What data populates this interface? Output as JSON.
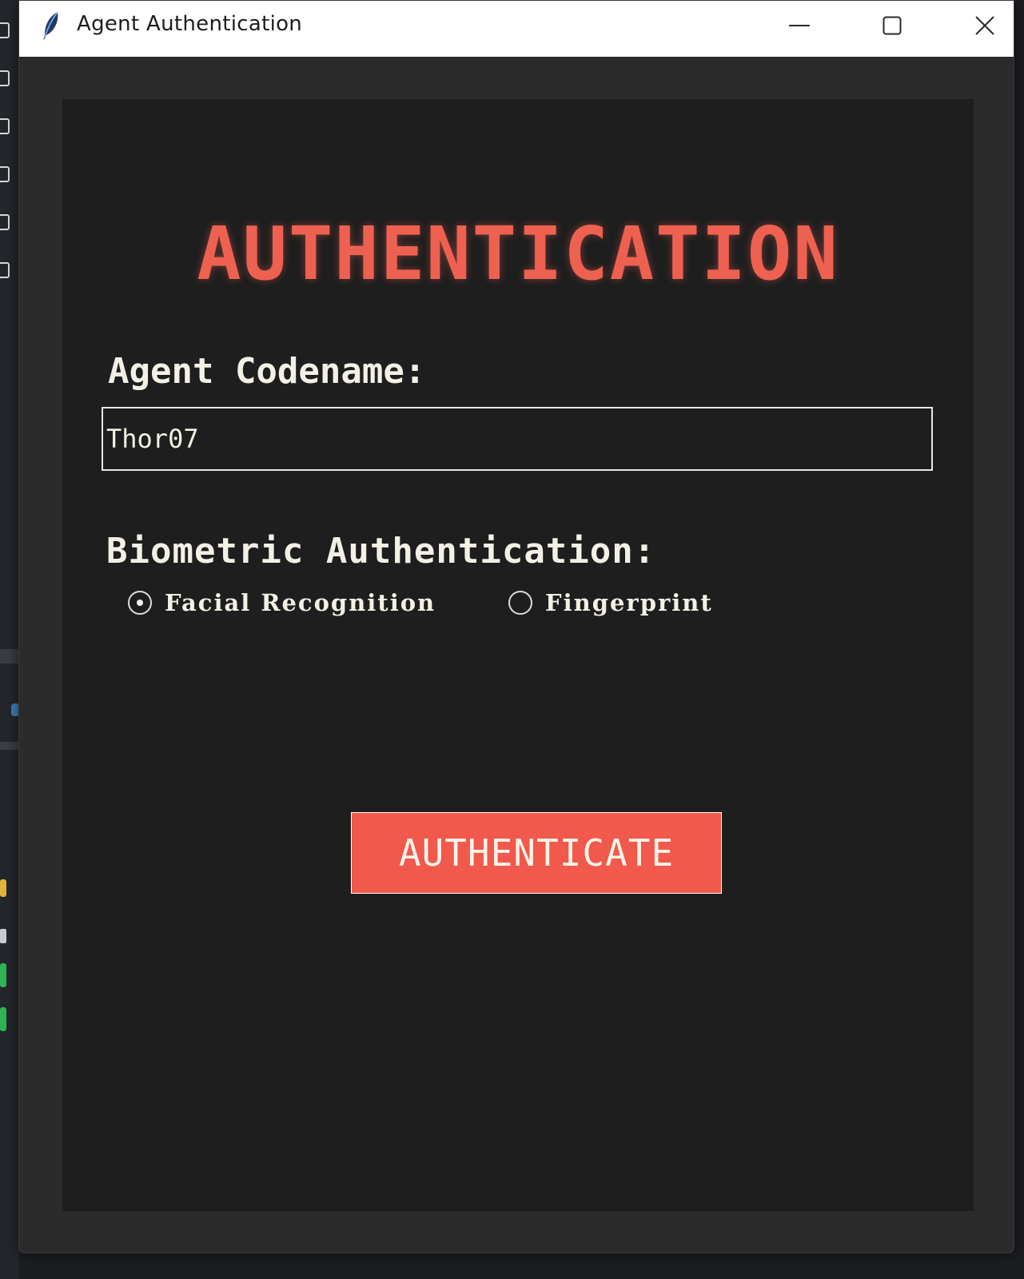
{
  "window": {
    "title": "Agent Authentication",
    "minimize_icon": "minimize-icon",
    "maximize_icon": "maximize-icon",
    "close_icon": "close-icon",
    "app_icon": "feather-icon"
  },
  "form": {
    "heading": "AUTHENTICATION",
    "codename_label": "Agent Codename:",
    "codename_value": "Thor07",
    "biometric_label": "Biometric Authentication:",
    "biometric_options": [
      {
        "label": "Facial Recognition",
        "selected": true
      },
      {
        "label": "Fingerprint",
        "selected": false
      }
    ],
    "submit_label": "AUTHENTICATE"
  },
  "colors": {
    "accent": "#ee6151",
    "button": "#f0594b",
    "panel_bg": "#1e1e1e",
    "window_bg": "#2b2b2b",
    "text": "#f3f0e6"
  }
}
